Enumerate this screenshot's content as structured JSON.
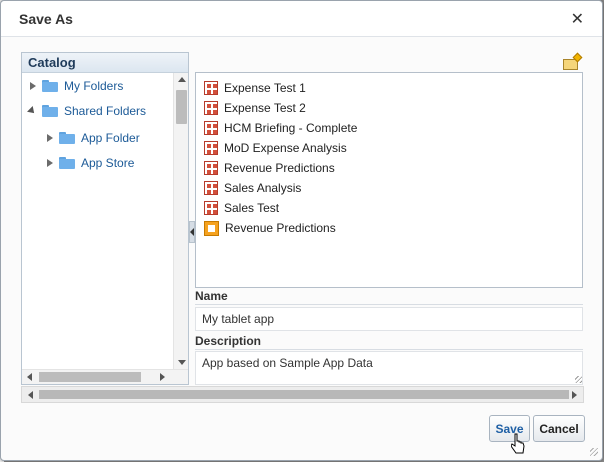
{
  "dialog": {
    "title": "Save As",
    "close_glyph": "✕"
  },
  "catalog": {
    "header": "Catalog",
    "tree": [
      {
        "label": "My Folders",
        "expanded": false,
        "level": 0,
        "icon": "folder-icon"
      },
      {
        "label": "Shared Folders",
        "expanded": true,
        "level": 0,
        "icon": "folder-icon"
      },
      {
        "label": "App Folder",
        "expanded": false,
        "level": 1,
        "icon": "folder-icon"
      },
      {
        "label": "App Store",
        "expanded": false,
        "level": 1,
        "icon": "folder-icon"
      }
    ]
  },
  "toolbar": {
    "new_folder_icon": "new-folder-icon"
  },
  "files": [
    {
      "label": "Expense Test 1",
      "icon": "analysis-icon"
    },
    {
      "label": "Expense Test 2",
      "icon": "analysis-icon"
    },
    {
      "label": "HCM Briefing - Complete",
      "icon": "analysis-icon"
    },
    {
      "label": "MoD Expense Analysis",
      "icon": "analysis-icon"
    },
    {
      "label": "Revenue Predictions",
      "icon": "analysis-icon"
    },
    {
      "label": "Sales Analysis",
      "icon": "analysis-icon"
    },
    {
      "label": "Sales Test",
      "icon": "analysis-icon"
    },
    {
      "label": "Revenue Predictions",
      "icon": "dashboard-icon"
    }
  ],
  "form": {
    "name_label": "Name",
    "name_value": "My tablet app",
    "description_label": "Description",
    "description_value": "App based on Sample App Data"
  },
  "buttons": {
    "save_label": "Save",
    "cancel_label": "Cancel"
  },
  "colors": {
    "link_blue": "#1c5a97",
    "save_blue": "#1e5fa5",
    "folder_blue": "#6fb0ea"
  }
}
